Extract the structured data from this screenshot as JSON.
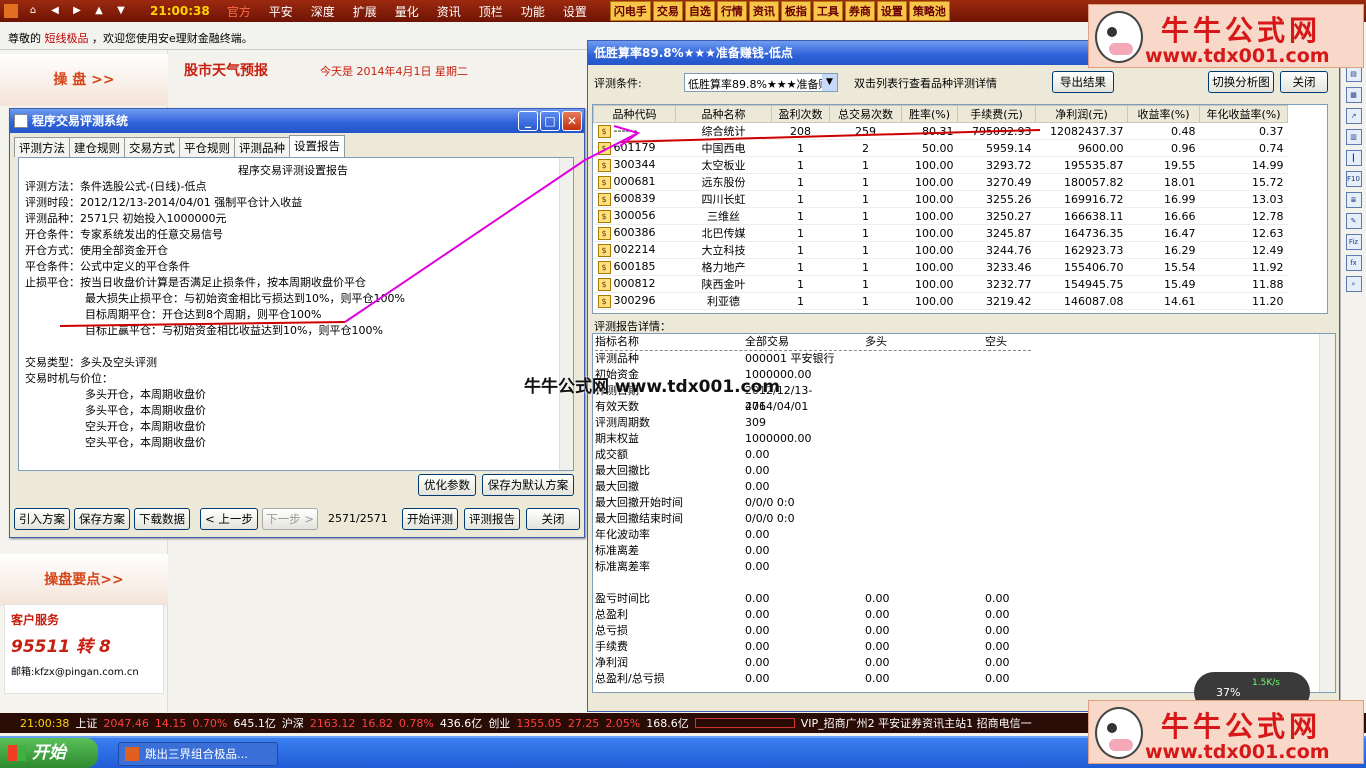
{
  "topbar": {
    "clock": "21:00:38",
    "menus": [
      "官方",
      "平安",
      "深度",
      "扩展",
      "量化",
      "资讯",
      "顶栏",
      "功能",
      "设置"
    ],
    "quick": [
      "闪电手",
      "交易",
      "自选",
      "行情",
      "资讯",
      "板指",
      "工具",
      "券商",
      "设置",
      "策略池"
    ]
  },
  "marquee": {
    "pre": "尊敬的",
    "hl": "短线极品",
    "post": "，欢迎您使用安e理财金融终端。"
  },
  "nav": {
    "top": "操 盘 >>",
    "mid": "操盘要点>>"
  },
  "service": {
    "title": "客户服务",
    "phone": "95511 转 8",
    "email": "邮箱:kfzx@pingan.com.cn"
  },
  "head": {
    "weather": "股市天气预报",
    "date": "今天是 2014年4月1日 星期二"
  },
  "dialog1": {
    "title": "程序交易评测系统",
    "tabs": [
      "评测方法",
      "建仓规则",
      "交易方式",
      "平仓规则",
      "评测品种",
      "设置报告"
    ],
    "report_title": "程序交易评测设置报告",
    "lines": [
      {
        "t": "评测方法：条件选股公式-(日线)-低点",
        "i": false
      },
      {
        "t": "评测时段：2012/12/13-2014/04/01  强制平仓计入收益",
        "i": false
      },
      {
        "t": "评测品种：2571只  初始投入1000000元",
        "i": false
      },
      {
        "t": "开仓条件：专家系统发出的任意交易信号",
        "i": false
      },
      {
        "t": "开仓方式：使用全部资金开仓",
        "i": false
      },
      {
        "t": "平仓条件：公式中定义的平仓条件",
        "i": false
      },
      {
        "t": "止损平仓：按当日收盘价计算是否满足止损条件，按本周期收盘价平仓",
        "i": false
      },
      {
        "t": "最大损失止损平仓：与初始资金相比亏损达到10%，则平仓100%",
        "i": true
      },
      {
        "t": "目标周期平仓：开仓达到8个周期，则平仓100%",
        "i": true
      },
      {
        "t": "目标止赢平仓：与初始资金相比收益达到10%，则平仓100%",
        "i": true
      },
      {
        "t": "",
        "i": false
      },
      {
        "t": "交易类型：多头及空头评测",
        "i": false
      },
      {
        "t": "交易时机与价位：",
        "i": false
      },
      {
        "t": "多头开仓，本周期收盘价",
        "i": true
      },
      {
        "t": "多头平仓，本周期收盘价",
        "i": true
      },
      {
        "t": "空头开仓，本周期收盘价",
        "i": true
      },
      {
        "t": "空头平仓，本周期收盘价",
        "i": true
      }
    ],
    "btn_opt": "优化参数",
    "btn_save_default": "保存为默认方案",
    "btn_import": "引入方案",
    "btn_save": "保存方案",
    "btn_download": "下载数据",
    "btn_prev": "< 上一步",
    "btn_next": "下一步 >",
    "progress": "2571/2571",
    "btn_start": "开始评测",
    "btn_report": "评测报告",
    "btn_close": "关闭"
  },
  "dialog2": {
    "title": "低胜算率89.8%★★★准备赚钱-低点",
    "cond_label": "评测条件:",
    "cond_value": "低胜算率89.8%★★★准备赚钱",
    "hint": "双击列表行查看品种评测详情",
    "btn_export": "导出结果",
    "btn_switch": "切换分析图",
    "btn_close": "关闭",
    "columns": [
      "品种代码",
      "品种名称",
      "盈利次数",
      "总交易次数",
      "胜率(%)",
      "手续费(元)",
      "净利润(元)",
      "收益率(%)",
      "年化收益率(%)"
    ],
    "rows": [
      [
        "------",
        "综合统计",
        "208",
        "259",
        "80.31",
        "795092.93",
        "12082437.37",
        "0.48",
        "0.37"
      ],
      [
        "601179",
        "中国西电",
        "1",
        "2",
        "50.00",
        "5959.14",
        "9600.00",
        "0.96",
        "0.74"
      ],
      [
        "300344",
        "太空板业",
        "1",
        "1",
        "100.00",
        "3293.72",
        "195535.87",
        "19.55",
        "14.99"
      ],
      [
        "000681",
        "远东股份",
        "1",
        "1",
        "100.00",
        "3270.49",
        "180057.82",
        "18.01",
        "15.72"
      ],
      [
        "600839",
        "四川长虹",
        "1",
        "1",
        "100.00",
        "3255.26",
        "169916.72",
        "16.99",
        "13.03"
      ],
      [
        "300056",
        "三维丝",
        "1",
        "1",
        "100.00",
        "3250.27",
        "166638.11",
        "16.66",
        "12.78"
      ],
      [
        "600386",
        "北巴传媒",
        "1",
        "1",
        "100.00",
        "3245.87",
        "164736.35",
        "16.47",
        "12.63"
      ],
      [
        "002214",
        "大立科技",
        "1",
        "1",
        "100.00",
        "3244.76",
        "162923.73",
        "16.29",
        "12.49"
      ],
      [
        "600185",
        "格力地产",
        "1",
        "1",
        "100.00",
        "3233.46",
        "155406.70",
        "15.54",
        "11.92"
      ],
      [
        "000812",
        "陕西金叶",
        "1",
        "1",
        "100.00",
        "3232.77",
        "154945.75",
        "15.49",
        "11.88"
      ],
      [
        "300296",
        "利亚德",
        "1",
        "1",
        "100.00",
        "3219.42",
        "146087.08",
        "14.61",
        "11.20"
      ]
    ],
    "detail_label": "评测报告详情：",
    "detail_head": [
      "指标名称",
      "全部交易",
      "多头",
      "空头"
    ],
    "detail_rows": [
      [
        "评测品种",
        "000001 平安银行",
        "",
        ""
      ],
      [
        "初始资金",
        "1000000.00",
        "",
        ""
      ],
      [
        "评测日期",
        "2012/12/13-2014/04/01",
        "",
        ""
      ],
      [
        "有效天数",
        "476",
        "",
        ""
      ],
      [
        "评测周期数",
        "309",
        "",
        ""
      ],
      [
        "期末权益",
        "1000000.00",
        "",
        ""
      ],
      [
        "成交额",
        "0.00",
        "",
        ""
      ],
      [
        "最大回撤比",
        "0.00",
        "",
        ""
      ],
      [
        "最大回撤",
        "0.00",
        "",
        ""
      ],
      [
        "最大回撤开始时间",
        "0/0/0 0:0",
        "",
        ""
      ],
      [
        "最大回撤结束时间",
        "0/0/0 0:0",
        "",
        ""
      ],
      [
        "年化波动率",
        "0.00",
        "",
        ""
      ],
      [
        "标准离差",
        "0.00",
        "",
        ""
      ],
      [
        "标准离差率",
        "0.00",
        "",
        ""
      ],
      [
        "",
        "",
        "",
        ""
      ],
      [
        "盈亏时间比",
        "0.00",
        "0.00",
        "0.00"
      ],
      [
        "总盈利",
        "0.00",
        "0.00",
        "0.00"
      ],
      [
        "总亏损",
        "0.00",
        "0.00",
        "0.00"
      ],
      [
        "手续费",
        "0.00",
        "0.00",
        "0.00"
      ],
      [
        "净利润",
        "0.00",
        "0.00",
        "0.00"
      ],
      [
        "总盈利/总亏损",
        "0.00",
        "0.00",
        "0.00"
      ]
    ]
  },
  "status": {
    "time": "21:00:38",
    "sh_label": "上证",
    "sh": "2047.46",
    "sh_ch": "14.15",
    "sh_pct": "0.70%",
    "sh_amt": "645.1亿",
    "sz_label": "沪深",
    "sz": "2163.12",
    "sz_ch": "16.82",
    "sz_pct": "0.78%",
    "sz_amt": "436.6亿",
    "cy_label": "创业",
    "cy": "1355.05",
    "cy_ch": "27.25",
    "cy_pct": "2.05%",
    "cy_amt": "168.6亿",
    "servers": "VIP_招商广州2  平安证券资讯主站1  招商电信一"
  },
  "taskbar": {
    "start": "开始",
    "task": "跳出三界组合极品..."
  },
  "watermark": {
    "t1": "牛牛公式网",
    "t2": "www.tdx001.com",
    "mid": "牛牛公式网 www.tdx001.com"
  },
  "speed": {
    "pct": "37%",
    "rate": "1.5K/s"
  },
  "colors": {
    "title_red": "#c82010",
    "accent_line": "#cc0000",
    "arrow": "#e000e0"
  }
}
